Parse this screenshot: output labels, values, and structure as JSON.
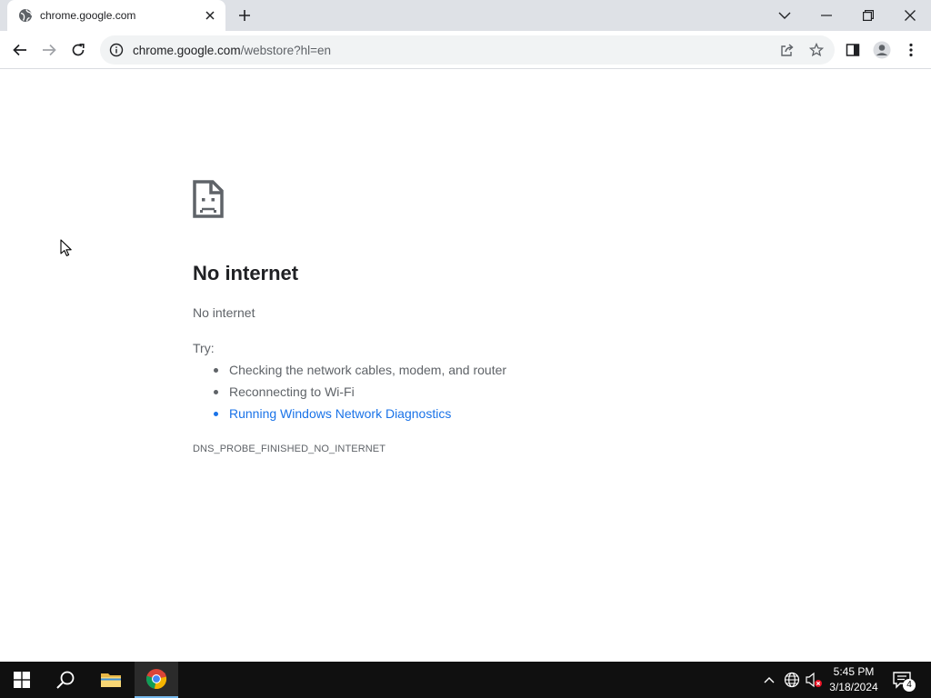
{
  "tab": {
    "title": "chrome.google.com",
    "favicon": "globe-icon"
  },
  "toolbar": {
    "url_host": "chrome.google.com",
    "url_path": "/webstore?hl=en"
  },
  "error": {
    "icon": "sad-page-icon",
    "title": "No internet",
    "subtitle": "No internet",
    "try_label": "Try:",
    "suggestions": [
      "Checking the network cables, modem, and router",
      "Reconnecting to Wi-Fi"
    ],
    "diagnostics_link": "Running Windows Network Diagnostics",
    "error_code": "DNS_PROBE_FINISHED_NO_INTERNET"
  },
  "taskbar": {
    "time": "5:45 PM",
    "date": "3/18/2024",
    "notification_count": "4",
    "apps": [
      "windows-start-icon",
      "search-icon",
      "file-explorer-icon",
      "chrome-icon"
    ]
  },
  "colors": {
    "link": "#1a73e8",
    "tabstrip": "#dee1e6",
    "taskbar": "#101010",
    "accent": "#76b9ed"
  }
}
